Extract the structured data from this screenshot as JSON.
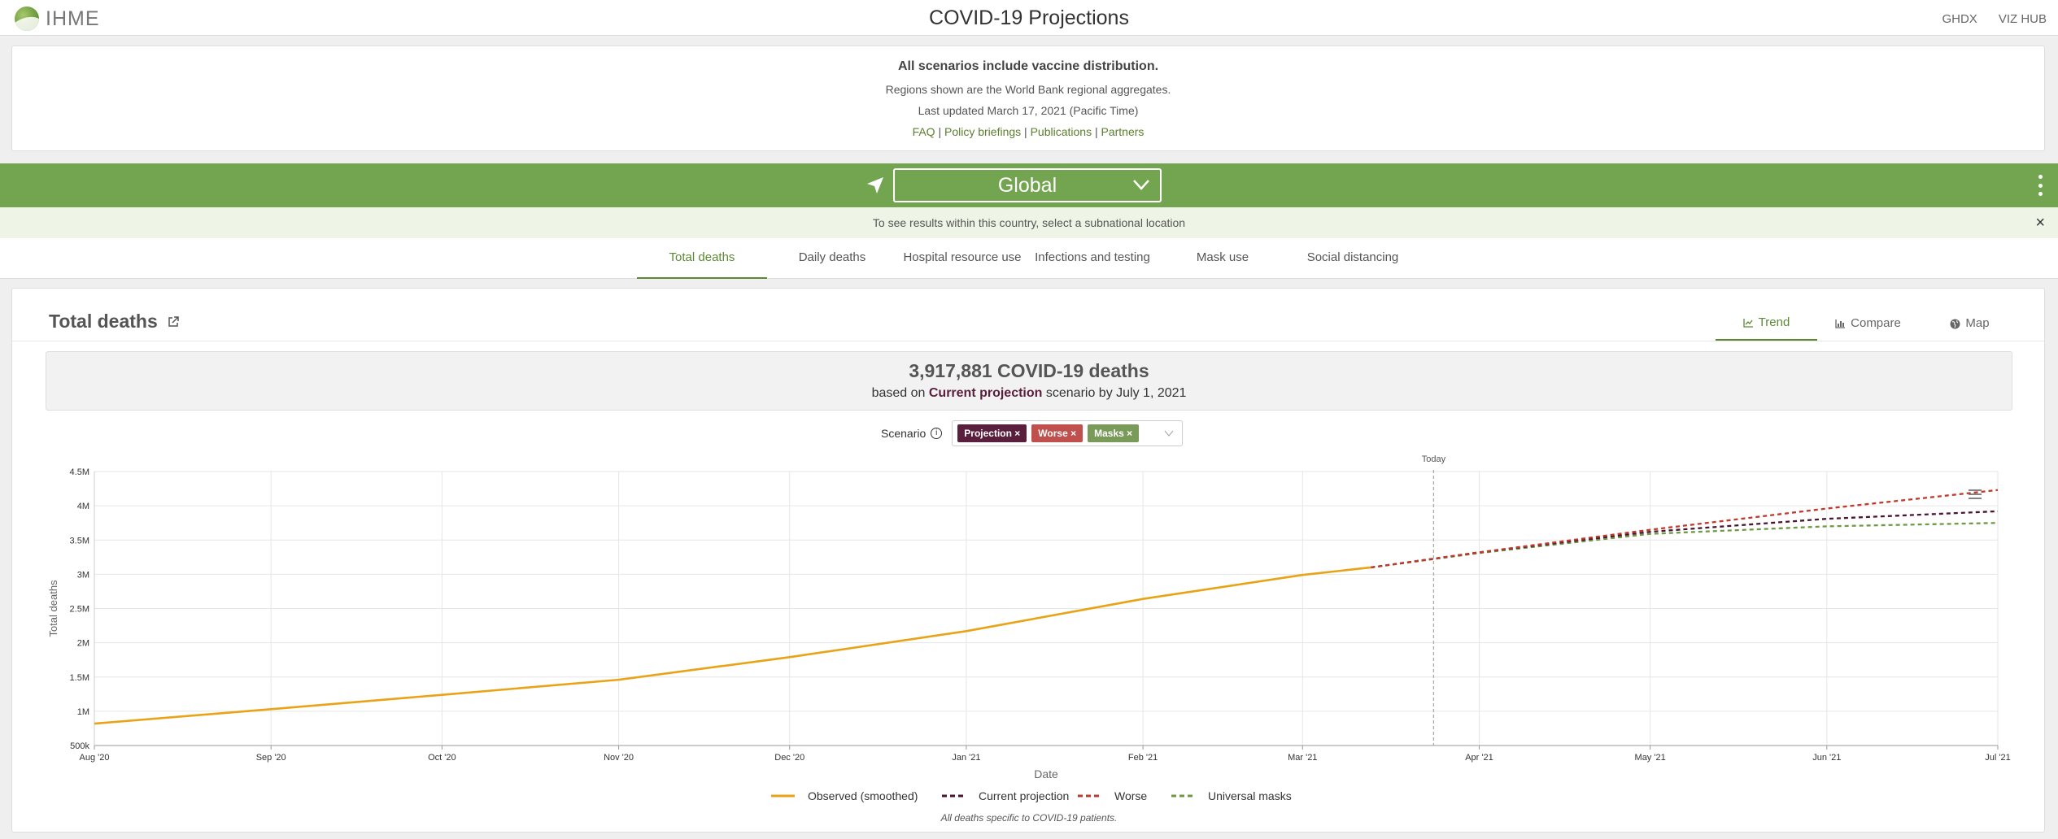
{
  "header": {
    "logo_text": "IHME",
    "title": "COVID-19 Projections",
    "links": [
      "GHDX",
      "VIZ HUB"
    ]
  },
  "info": {
    "line1": "All scenarios include vaccine distribution.",
    "line2": "Regions shown are the World Bank regional aggregates.",
    "line3": "Last updated March 17, 2021 (Pacific Time)",
    "links": [
      "FAQ",
      "Policy briefings",
      "Publications",
      "Partners"
    ],
    "separator": "|"
  },
  "location": {
    "selected": "Global",
    "notice": "To see results within this country, select a subnational location",
    "close_glyph": "×"
  },
  "tabs": [
    "Total deaths",
    "Daily deaths",
    "Hospital resource use",
    "Infections and testing",
    "Mask use",
    "Social distancing"
  ],
  "active_tab": 0,
  "card": {
    "title": "Total deaths",
    "views": [
      "Trend",
      "Compare",
      "Map"
    ],
    "active_view": 0
  },
  "summary": {
    "headline": "3,917,881 COVID-19 deaths",
    "prefix": "based on",
    "scenario": "Current projection",
    "suffix": "scenario by July 1, 2021"
  },
  "scenario_filter": {
    "label": "Scenario",
    "chips": [
      {
        "label": "Projection ×",
        "color": "#5a1f3c"
      },
      {
        "label": "Worse ×",
        "color": "#c0504d"
      },
      {
        "label": "Masks ×",
        "color": "#7a9a5a"
      }
    ]
  },
  "colors": {
    "observed": "#e8a317",
    "current": "#4a1530",
    "worse": "#c0392b",
    "masks": "#6e9a43",
    "accent": "#5b8a32",
    "bar": "#73a44f"
  },
  "chart_data": {
    "type": "line",
    "xlabel": "Date",
    "ylabel": "Total deaths",
    "x_ticks": [
      "Aug '20",
      "Sep '20",
      "Oct '20",
      "Nov '20",
      "Dec '20",
      "Jan '21",
      "Feb '21",
      "Mar '21",
      "Apr '21",
      "May '21",
      "Jun '21",
      "Jul '21"
    ],
    "x_tick_dates": [
      "2020-08-01",
      "2020-09-01",
      "2020-10-01",
      "2020-11-01",
      "2020-12-01",
      "2021-01-01",
      "2021-02-01",
      "2021-03-01",
      "2021-04-01",
      "2021-05-01",
      "2021-06-01",
      "2021-07-01"
    ],
    "y_ticks": [
      "500k",
      "1M",
      "1.5M",
      "2M",
      "2.5M",
      "3M",
      "3.5M",
      "4M",
      "4.5M"
    ],
    "ylim": [
      500000,
      4500000
    ],
    "xlim": [
      "2020-08-01",
      "2021-07-01"
    ],
    "today_label": "Today",
    "today_date": "2021-03-24",
    "grid": true,
    "legend_position": "bottom",
    "footnote": "All deaths specific to COVID-19 patients.",
    "series": [
      {
        "name": "Observed (smoothed)",
        "style": "solid",
        "x": [
          "2020-08-01",
          "2020-09-01",
          "2020-10-01",
          "2020-11-01",
          "2020-12-01",
          "2021-01-01",
          "2021-02-01",
          "2021-03-01",
          "2021-03-13"
        ],
        "y": [
          820000,
          1030000,
          1240000,
          1460000,
          1790000,
          2170000,
          2640000,
          2990000,
          3100000
        ]
      },
      {
        "name": "Current projection",
        "style": "dashed",
        "x": [
          "2021-03-13",
          "2021-04-01",
          "2021-05-01",
          "2021-06-01",
          "2021-07-01"
        ],
        "y": [
          3100000,
          3320000,
          3620000,
          3810000,
          3920000
        ]
      },
      {
        "name": "Worse",
        "style": "dashed",
        "x": [
          "2021-03-13",
          "2021-04-01",
          "2021-05-01",
          "2021-06-01",
          "2021-07-01"
        ],
        "y": [
          3100000,
          3320000,
          3650000,
          3960000,
          4230000
        ]
      },
      {
        "name": "Universal masks",
        "style": "dashed",
        "x": [
          "2021-03-13",
          "2021-04-01",
          "2021-05-01",
          "2021-06-01",
          "2021-07-01"
        ],
        "y": [
          3100000,
          3310000,
          3590000,
          3700000,
          3750000
        ]
      }
    ]
  }
}
